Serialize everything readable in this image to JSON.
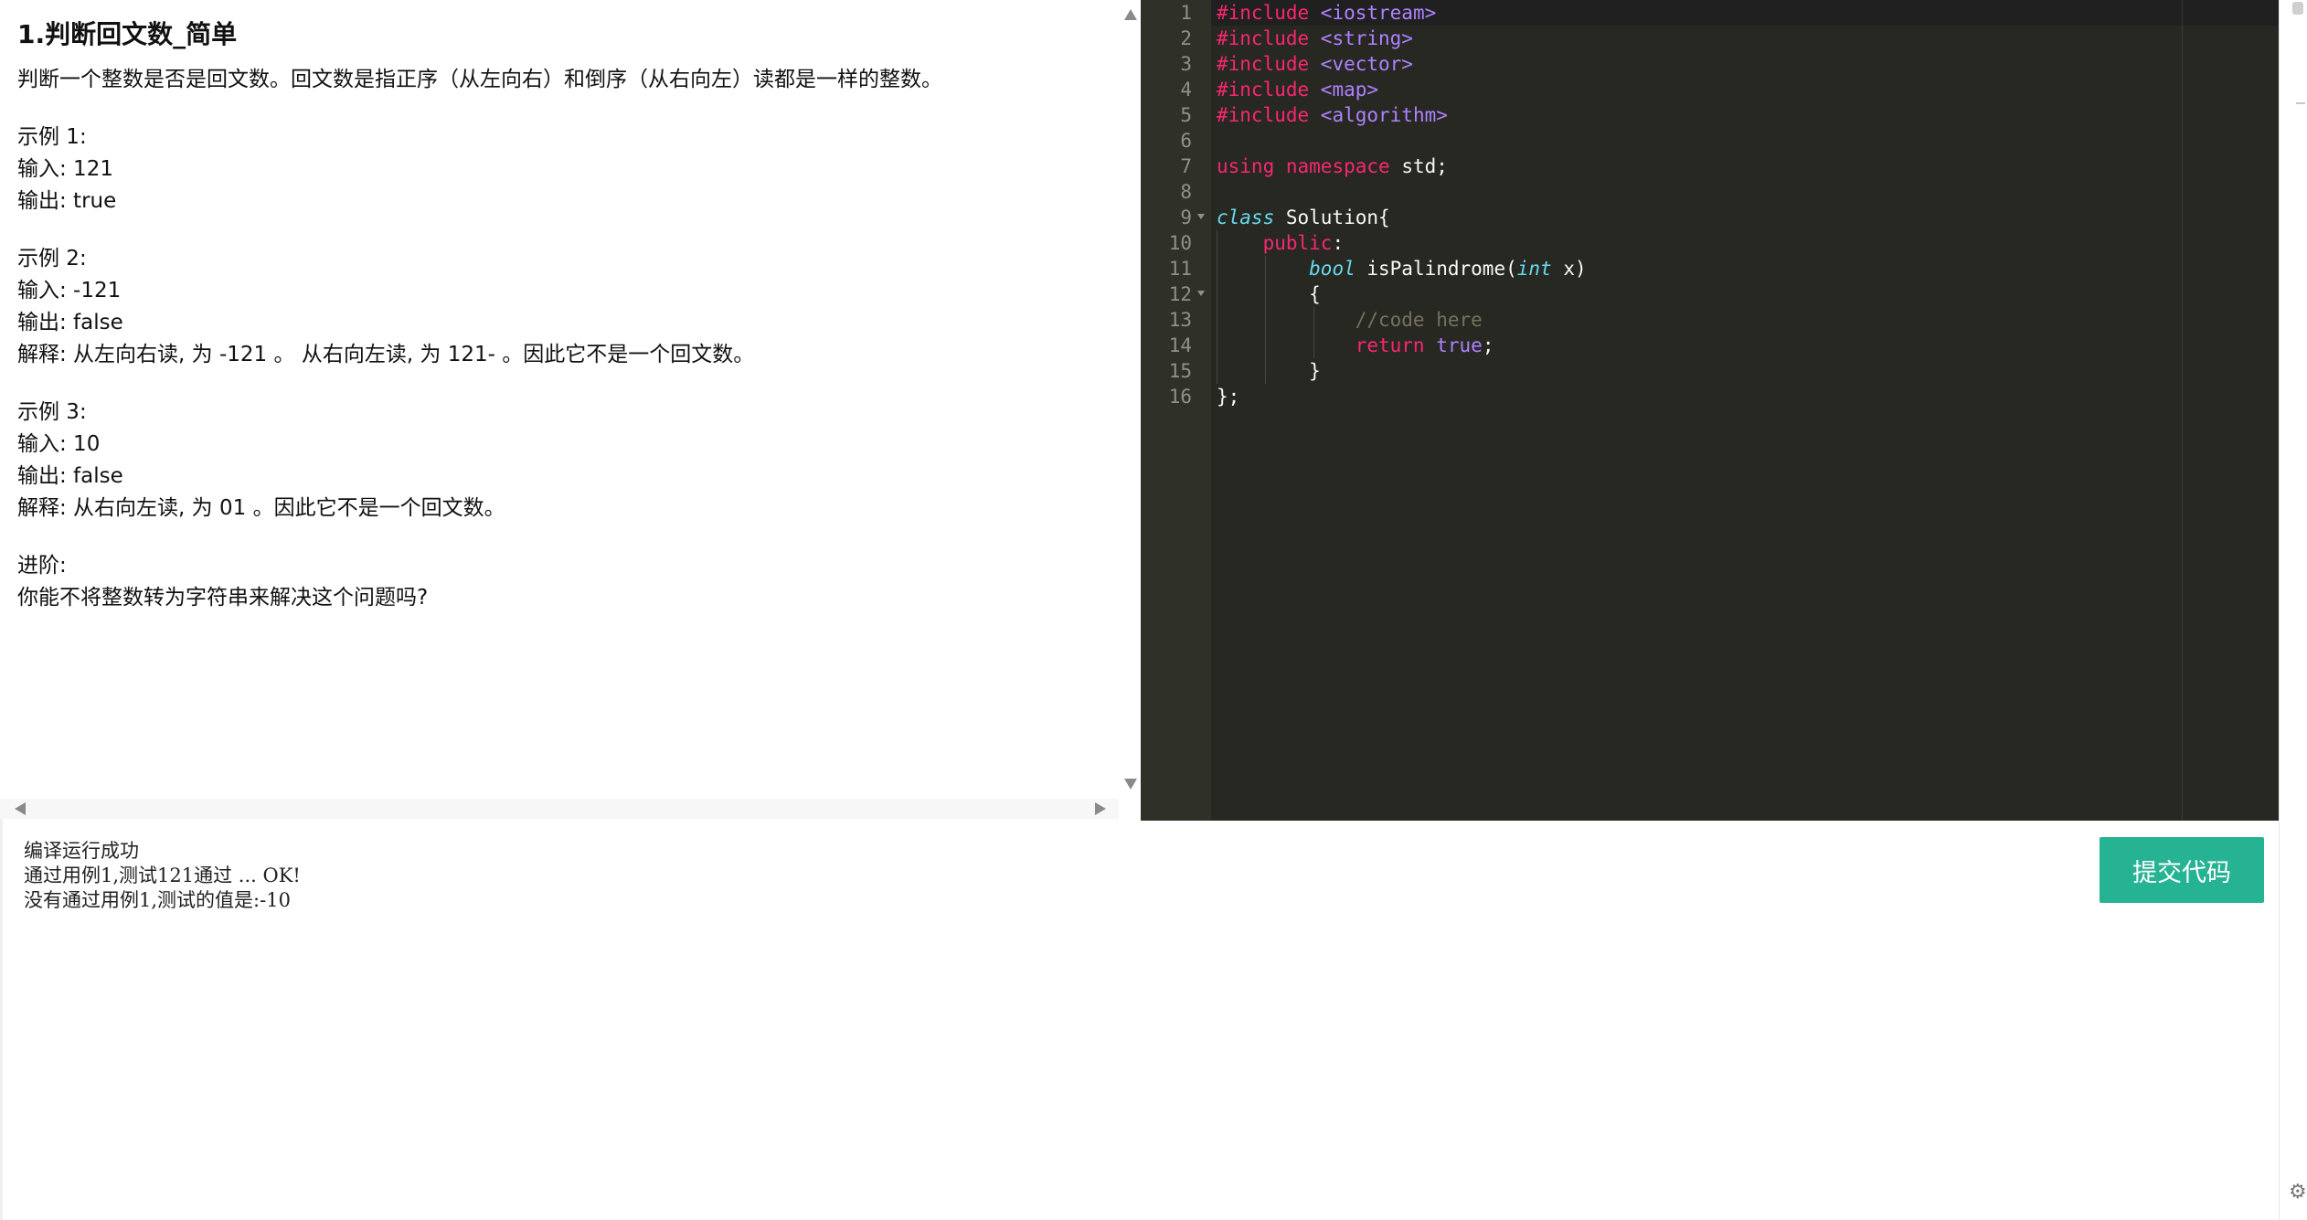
{
  "problem": {
    "title": "1.判断回文数_简单",
    "lines": [
      "判断一个整数是否是回文数。回文数是指正序（从左向右）和倒序（从右向左）读都是一样的整数。",
      "",
      "示例 1:",
      "输入: 121",
      "输出: true",
      "",
      "示例 2:",
      "输入: -121",
      "输出: false",
      "解释: 从左向右读, 为 -121 。 从右向左读, 为 121- 。因此它不是一个回文数。",
      "",
      "示例 3:",
      "输入: 10",
      "输出: false",
      "解释: 从右向左读, 为 01 。因此它不是一个回文数。",
      "",
      "进阶:",
      "你能不将整数转为字符串来解决这个问题吗?"
    ]
  },
  "editor": {
    "line_numbers": [
      "1",
      "2",
      "3",
      "4",
      "5",
      "6",
      "7",
      "8",
      "9",
      "10",
      "11",
      "12",
      "13",
      "14",
      "15",
      "16"
    ],
    "code": {
      "l1_kw": "#include",
      "l1_rest": " <iostream>",
      "l2_kw": "#include",
      "l2_rest": " <string>",
      "l3_kw": "#include",
      "l3_rest": " <vector>",
      "l4_kw": "#include",
      "l4_rest": " <map>",
      "l5_kw": "#include",
      "l5_rest": " <algorithm>",
      "l7_using": "using",
      "l7_ns": "namespace",
      "l7_rest": " std;",
      "l9_class": "class",
      "l9_rest": " Solution{",
      "l10_public": "public",
      "l10_colon": ":",
      "l11_type": "bool",
      "l11_name": " isPalindrome(",
      "l11_int": "int",
      "l11_rest": " x)",
      "l12": "{",
      "l13_comment": "//code here",
      "l14_return": "return",
      "l14_true": "true",
      "l14_semi": ";",
      "l15": "}",
      "l16": "};"
    }
  },
  "output": {
    "lines": [
      "编译运行成功",
      "通过用例1,测试121通过 ... OK!",
      "没有通过用例1,测试的值是:-10"
    ]
  },
  "submit_label": "提交代码",
  "right_strip": {
    "gear_icon": "⚙"
  },
  "colors": {
    "editor_bg": "#272822",
    "gutter_bg": "#2f3129",
    "submit_bg": "#26b393"
  }
}
